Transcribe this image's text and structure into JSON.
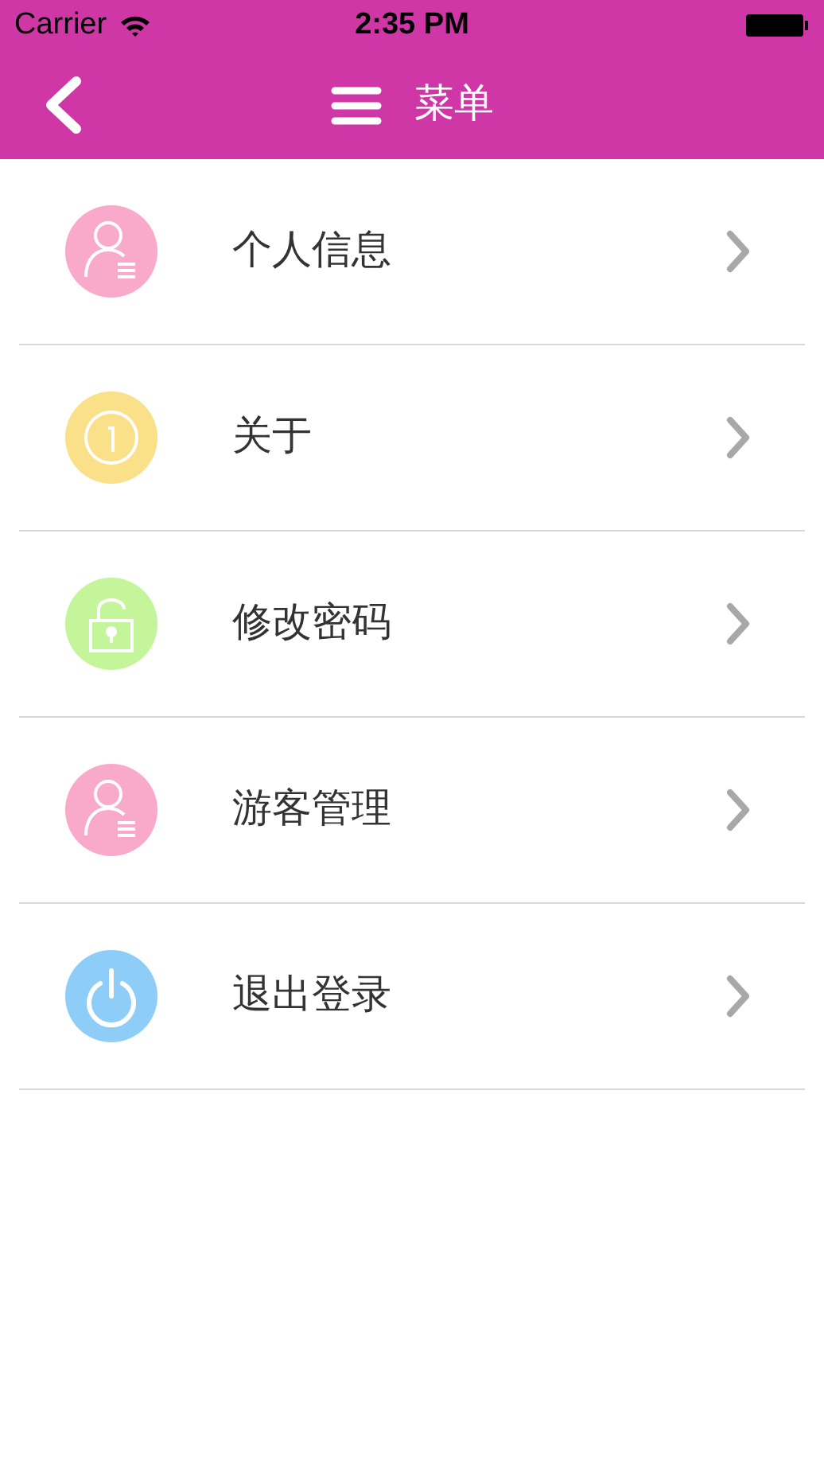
{
  "status_bar": {
    "carrier": "Carrier",
    "time": "2:35 PM"
  },
  "nav_bar": {
    "title": "菜单"
  },
  "menu": [
    {
      "label": "个人信息",
      "kind": "person",
      "color": "#f9a9c9"
    },
    {
      "label": "关于",
      "kind": "info",
      "color": "#fbe08a"
    },
    {
      "label": "修改密码",
      "kind": "lock",
      "color": "#c5f59a"
    },
    {
      "label": "游客管理",
      "kind": "person",
      "color": "#f9a9c9"
    },
    {
      "label": "退出登录",
      "kind": "power",
      "color": "#8ecdf7"
    }
  ]
}
